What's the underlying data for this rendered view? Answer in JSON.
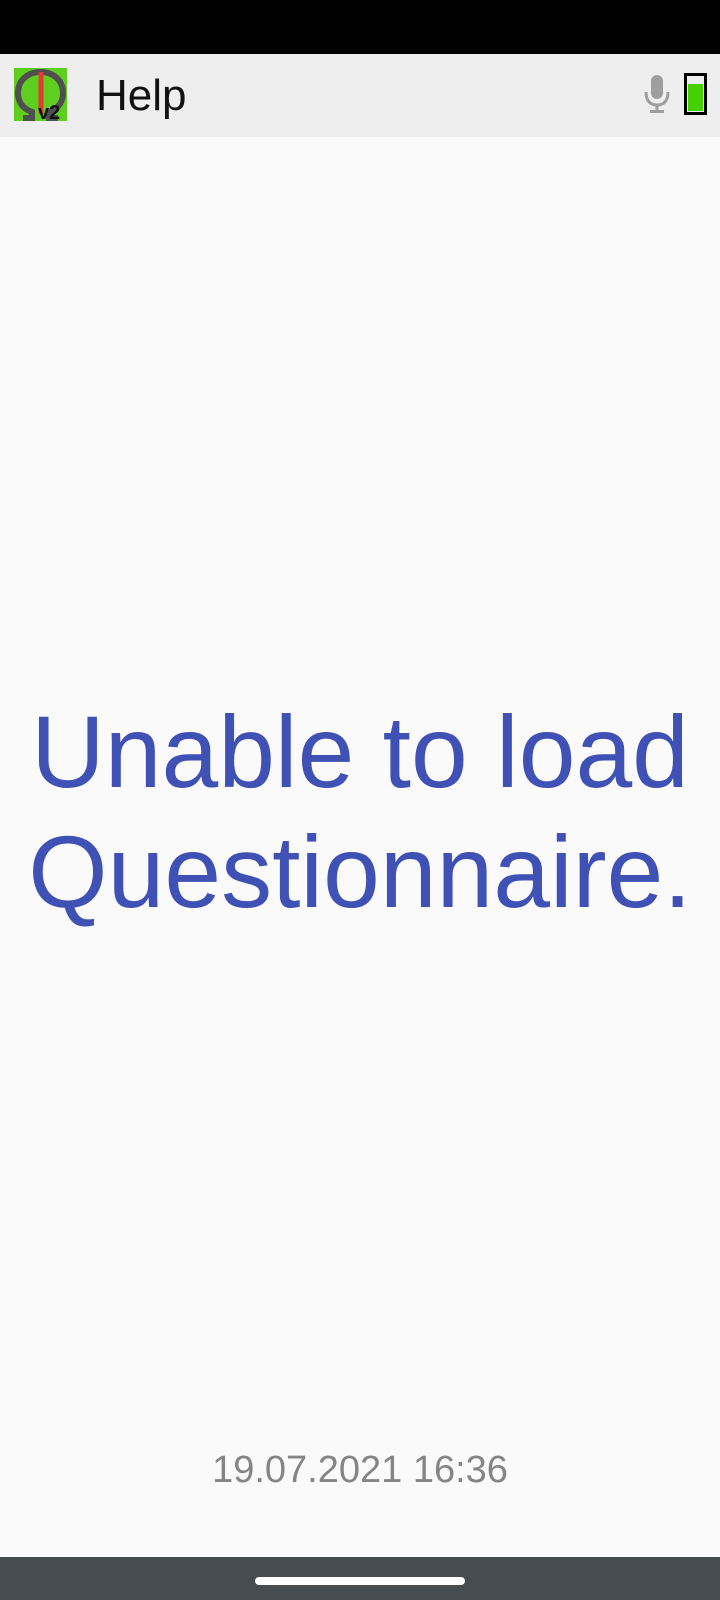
{
  "colors": {
    "status_bar": "#000000",
    "app_bar": "#eeeeee",
    "background": "#fafafa",
    "message": "#3f51b5",
    "timestamp": "#858585",
    "nav_bar": "#474c51",
    "logo_green": "#5fcf1f",
    "battery_green": "#44d100"
  },
  "app_bar": {
    "logo_icon": "app-logo-omega-v2-icon",
    "logo_badge": "v2",
    "title": "Help",
    "mic_icon": "microphone-icon",
    "battery_icon": "battery-icon"
  },
  "main": {
    "message_line1": "Unable to load",
    "message_line2": "Questionnaire."
  },
  "footer": {
    "timestamp": "19.07.2021 16:36"
  }
}
